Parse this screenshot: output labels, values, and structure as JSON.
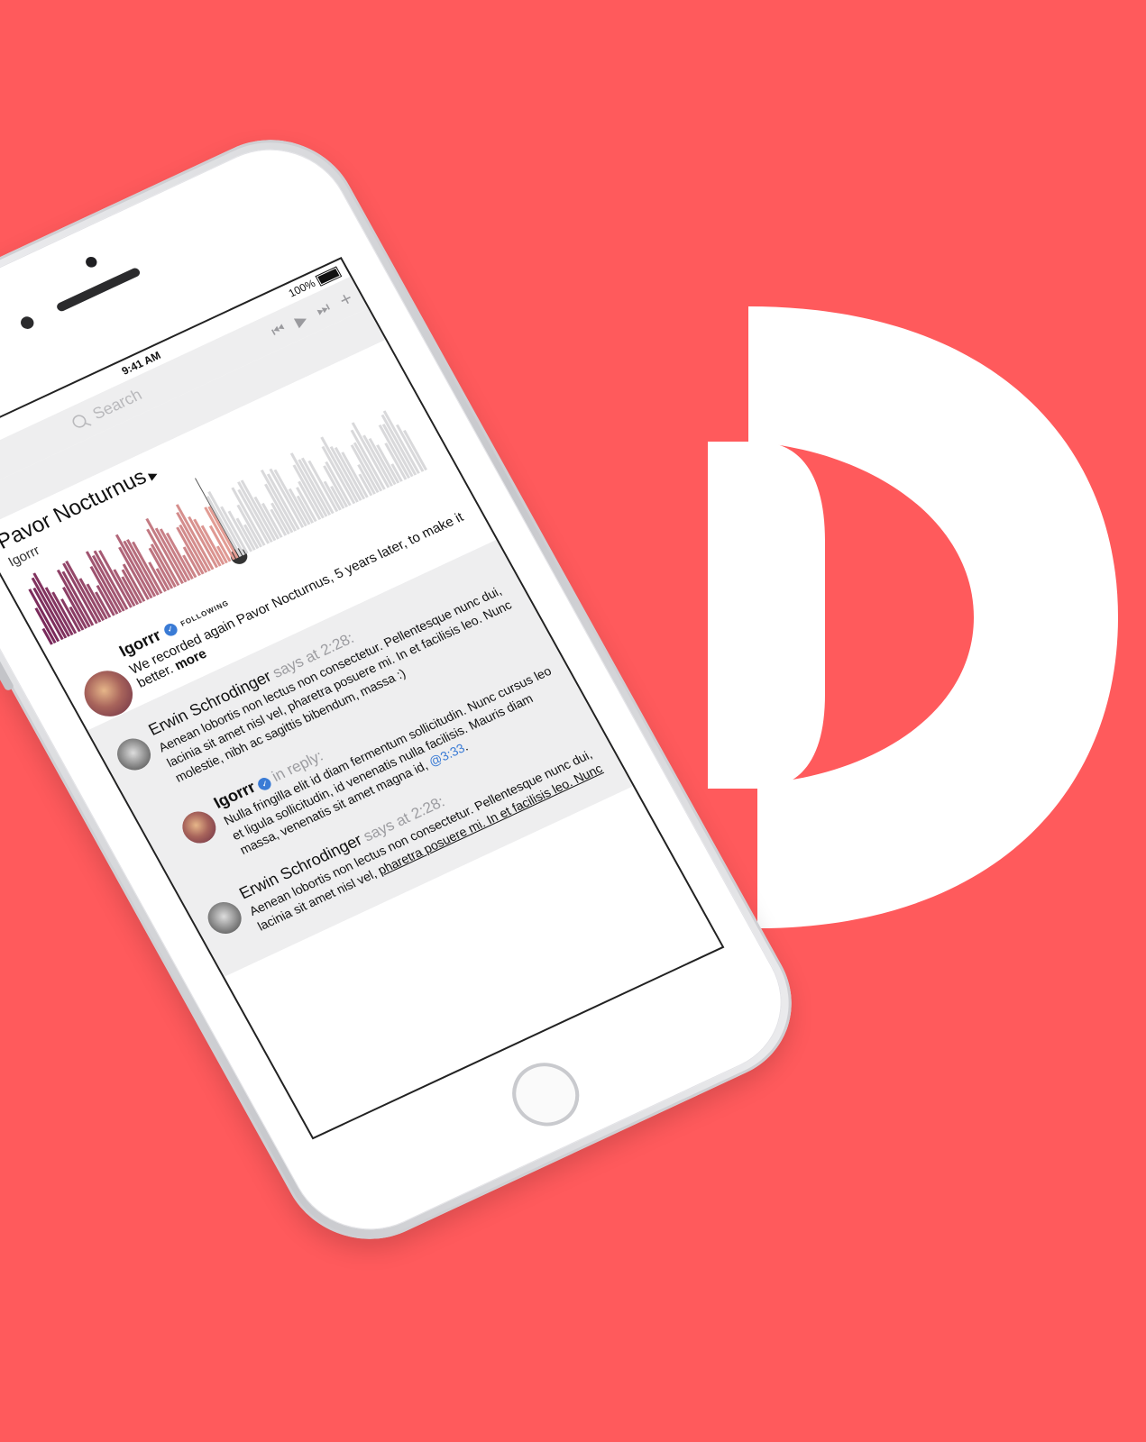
{
  "status_bar": {
    "signal": "•••••",
    "time": "9:41 AM",
    "battery": "100%"
  },
  "toolbar": {
    "search_placeholder": "Search",
    "controls": {
      "prev_icon": "skip-back-icon",
      "play_icon": "play-icon",
      "next_icon": "skip-forward-icon",
      "add_icon": "plus-icon"
    }
  },
  "track": {
    "title": "Pavor Nocturnus",
    "artist": "Igorrr"
  },
  "post": {
    "username": "Igorrr",
    "following_badge": "FOLLOWING",
    "text": "We recorded again Pavor Nocturnus, 5 years later, to make it better.",
    "more_label": "more"
  },
  "comments": [
    {
      "name": "Erwin Schrodinger",
      "meta": "says at 2:28:",
      "text": "Aenean lobortis non lectus non consectetur. Pellentesque nunc dui, lacinia sit amet nisl vel, pharetra posuere mi. In et facilisis leo. Nunc molestie, nibh ac sagittis bibendum, massa :)"
    },
    {
      "name": "Igorrr",
      "meta": "in reply:",
      "text": "Nulla fringilla elit id diam fermentum sollicitudin. Nunc cursus leo et ligula sollicitudin, id venenatis nulla facilisis. Mauris diam massa, venenatis sit amet magna id,",
      "mention": "@3:33",
      "mention_suffix": "."
    },
    {
      "name": "Erwin Schrodinger",
      "meta": "says at 2:28:",
      "text": "Aenean lobortis non lectus non consectetur. Pellentesque nunc dui, lacinia sit amet nisl vel,",
      "text_underlined": "pharetra posuere mi. In et facilisis leo. Nunc"
    }
  ],
  "colors": {
    "background": "#ff5a5c",
    "accent_blue": "#3a7bd5",
    "logo": "#ffffff"
  }
}
